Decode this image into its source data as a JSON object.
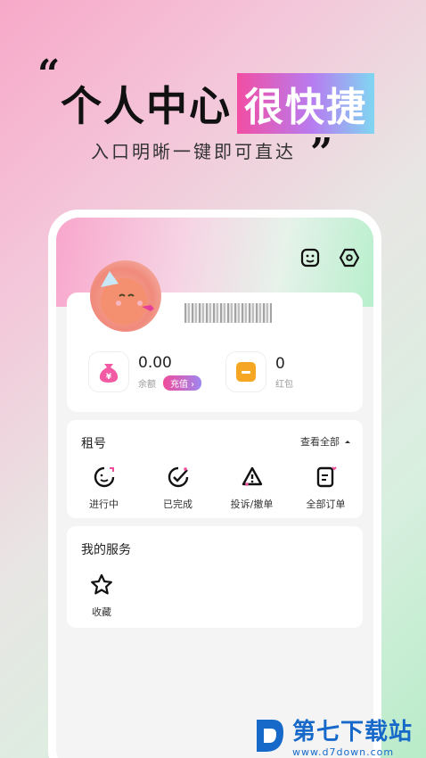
{
  "banner": {
    "quote_open": "“",
    "title_main": "个人中心",
    "title_accent": "很快捷",
    "subtitle": "入口明晰一键即可直达",
    "quote_close": "”"
  },
  "wallet": {
    "balance_value": "0.00",
    "balance_label": "余额",
    "recharge_label": "充值",
    "redpacket_value": "0",
    "redpacket_label": "红包"
  },
  "rent": {
    "title": "租号",
    "view_all": "查看全部",
    "items": [
      {
        "label": "进行中",
        "icon": "in-progress-icon"
      },
      {
        "label": "已完成",
        "icon": "completed-icon"
      },
      {
        "label": "投诉/撤单",
        "icon": "complaint-icon"
      },
      {
        "label": "全部订单",
        "icon": "all-orders-icon"
      }
    ]
  },
  "services": {
    "title": "我的服务",
    "items": [
      {
        "label": "收藏",
        "icon": "star-icon"
      }
    ]
  },
  "watermark": {
    "name": "第七下载站",
    "url": "www.d7down.com"
  },
  "colors": {
    "accent_pink": "#f04c9a",
    "wallet_pink": "#f25aa3",
    "wallet_orange": "#f5a623",
    "watermark_blue": "#1769c9"
  }
}
